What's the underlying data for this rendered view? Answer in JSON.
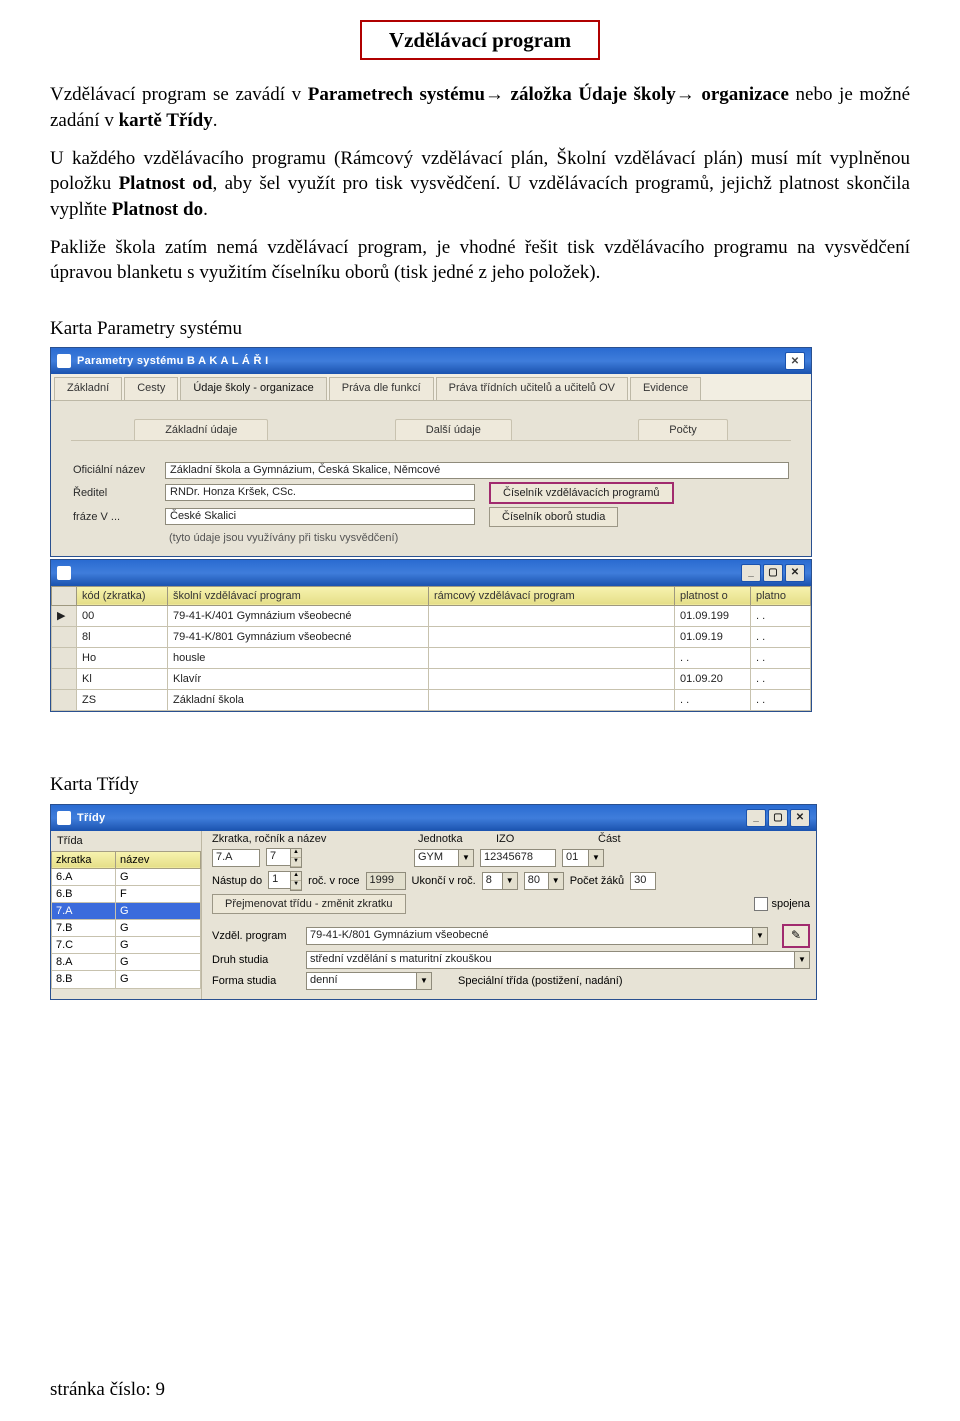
{
  "title": "Vzdělávací program",
  "para1_a": "Vzdělávací program se zavádí v ",
  "para1_b": "Parametrech systému→ záložka Údaje školy→ organizace",
  "para1_c": " nebo je možné  zadání v ",
  "para1_d": "kartě Třídy",
  "para1_e": ".",
  "para2_a": "U každého vzdělávacího programu (Rámcový vzdělávací plán, Školní vzdělávací plán) musí mít vyplněnou položku ",
  "para2_b": "Platnost od",
  "para2_c": ", aby šel využít pro tisk vysvědčení. U vzdělávacích programů, jejichž platnost skončila vyplňte ",
  "para2_d": "Platnost do",
  "para2_e": ".",
  "para3": "Pakliže škola zatím nemá vzdělávací program, je vhodné řešit tisk vzdělávacího programu na vysvědčení úpravou blanketu s využitím číselníku oborů (tisk jedné z jeho položek).",
  "section1": "Karta Parametry systému",
  "section2": "Karta Třídy",
  "win1": {
    "title": "Parametry systému  B A K A L Á Ř I",
    "outer_tabs": [
      "Základní",
      "Cesty",
      "Údaje školy - organizace",
      "Práva dle funkcí",
      "Práva třídních učitelů a učitelů OV",
      "Evidence"
    ],
    "inner_tabs": [
      "Základní údaje",
      "Další údaje",
      "Počty"
    ],
    "labels": {
      "off_name": "Oficiální název",
      "headmaster": "Ředitel",
      "phrase": "fráze V ..."
    },
    "fields": {
      "off_name": "Základní škola a Gymnázium, Česká Skalice, Němcové",
      "headmaster": "RNDr. Honza Kršek, CSc.",
      "phrase": "České Skalici"
    },
    "btn1": "Číselník vzdělávacích programů",
    "btn2": "Číselník oborů studia",
    "hint": "(tyto údaje jsou využívány při tisku vysvědčení)"
  },
  "win2": {
    "cols": [
      "kód (zkratka)",
      "školní vzdělávací program",
      "rámcový vzdělávací program",
      "platnost o",
      "platno"
    ],
    "rows": [
      [
        "00",
        "79-41-K/401 Gymnázium všeobecné",
        "",
        "01.09.199",
        ". ."
      ],
      [
        "8l",
        "79-41-K/801 Gymnázium všeobecné",
        "",
        "01.09.19",
        ". ."
      ],
      [
        "Ho",
        "housle",
        "",
        ". .",
        ". ."
      ],
      [
        "Kl",
        "Klavír",
        "",
        "01.09.20",
        ". ."
      ],
      [
        "ZS",
        "Základní škola",
        "",
        ". .",
        ". ."
      ]
    ]
  },
  "win3": {
    "title": "Třídy",
    "head_cols": [
      "Třída",
      "Zkratka, ročník a název",
      "Jednotka",
      "IZO",
      "Část"
    ],
    "left_cols": [
      "zkratka",
      "název"
    ],
    "left_rows": [
      [
        "6.A",
        "G"
      ],
      [
        "6.B",
        "F"
      ],
      [
        "7.A",
        "G"
      ],
      [
        "7.B",
        "G"
      ],
      [
        "7.C",
        "G"
      ],
      [
        "8.A",
        "G"
      ],
      [
        "8.B",
        "G"
      ]
    ],
    "selected_row": 2,
    "zkratka": "7.A",
    "rocnik": "7",
    "jednotka": "GYM",
    "izo": "12345678",
    "cast": "01",
    "l_nastup": "Nástup do",
    "nastup": "1",
    "l_rocvroce": "roč. v roce",
    "roc_v_roce": "1999",
    "l_ukonci": "Ukončí v roč.",
    "ukonci": "8",
    "nval": "80",
    "l_pocet": "Počet žáků",
    "pocet": "30",
    "btn_rename": "Přejmenovat třídu - změnit zkratku",
    "chk_spojena": "spojena",
    "l_vzdel": "Vzděl. program",
    "vzdel_program": "79-41-K/801 Gymnázium všeobecné",
    "l_druh": "Druh studia",
    "druh": "střední vzdělání s maturitní zkouškou",
    "l_forma": "Forma studia",
    "forma": "denní",
    "l_spec": "Speciální třída (postižení, nadání)"
  },
  "footer": "stránka číslo:  9"
}
